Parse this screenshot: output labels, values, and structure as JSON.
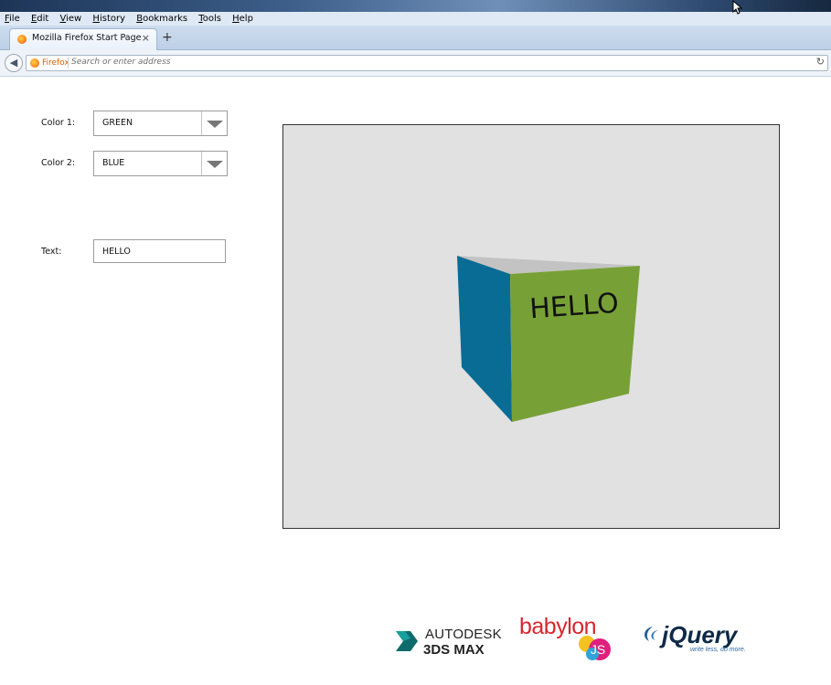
{
  "browser": {
    "menu": [
      "File",
      "Edit",
      "View",
      "History",
      "Bookmarks",
      "Tools",
      "Help"
    ],
    "tab": {
      "title": "Mozilla Firefox Start Page",
      "close_glyph": "×"
    },
    "new_tab_glyph": "+",
    "urlbar": {
      "identity_label": "Firefox",
      "placeholder": "Search or enter address"
    },
    "back_glyph": "◀",
    "reload_glyph": "↻"
  },
  "form": {
    "color1": {
      "label": "Color 1:",
      "value": "GREEN"
    },
    "color2": {
      "label": "Color 2:",
      "value": "BLUE"
    },
    "text": {
      "label": "Text:",
      "value": "HELLO"
    }
  },
  "scene": {
    "cube_text": "HELLO",
    "colors": {
      "background": "#e1e1e1",
      "front_face": "#77a136",
      "left_face": "#086c95",
      "top_face": "#c3c3c3"
    }
  },
  "logos": {
    "autodesk_line1": "AUTODESK",
    "autodesk_line2": "3DS MAX",
    "babylon": "babylon",
    "babylon_js": "JS",
    "jquery": "jQuery",
    "jquery_tagline": "write less, do more."
  }
}
